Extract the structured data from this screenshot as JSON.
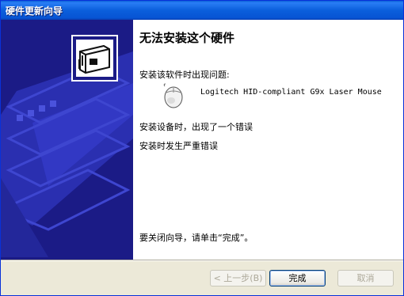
{
  "window": {
    "title": "硬件更新向导"
  },
  "main": {
    "heading": "无法安装这个硬件",
    "problem_intro": "安装该软件时出现问题:",
    "device_name": "Logitech HID-compliant G9x Laser Mouse",
    "error_line1": "安装设备时，出现了一个错误",
    "error_line2": "安装时发生严重错误",
    "finish_instruction": "要关闭向导，请单击“完成”。"
  },
  "buttons": {
    "back_label": "< 上一步(B)",
    "finish_label": "完成",
    "cancel_label": "取消"
  },
  "colors": {
    "side_panel": "#1b1b86",
    "title_bar": "#0b5fdc",
    "dialog_bg": "#ece9d8"
  },
  "icons": {
    "wizard_graphic": "hardware-card-icon",
    "device": "mouse-icon"
  }
}
